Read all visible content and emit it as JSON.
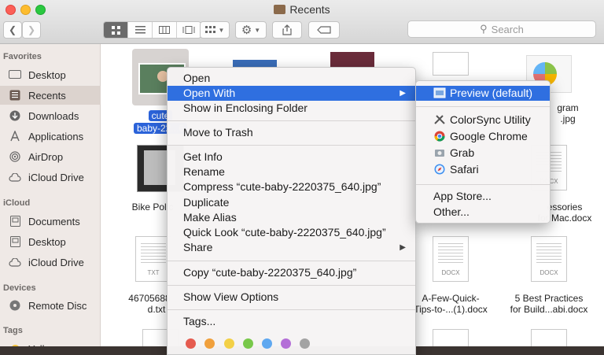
{
  "window": {
    "title": "Recents"
  },
  "toolbar": {
    "search_placeholder": "Search"
  },
  "sidebar": {
    "favorites_header": "Favorites",
    "favorites": [
      {
        "label": "Desktop",
        "icon": "desktop-icon"
      },
      {
        "label": "Recents",
        "icon": "recents-icon",
        "selected": true
      },
      {
        "label": "Downloads",
        "icon": "downloads-icon"
      },
      {
        "label": "Applications",
        "icon": "applications-icon"
      },
      {
        "label": "AirDrop",
        "icon": "airdrop-icon"
      },
      {
        "label": "iCloud Drive",
        "icon": "cloud-icon"
      }
    ],
    "icloud_header": "iCloud",
    "icloud": [
      {
        "label": "Documents",
        "icon": "documents-icon"
      },
      {
        "label": "Desktop",
        "icon": "desktop-icon"
      },
      {
        "label": "iCloud Drive",
        "icon": "cloud-icon"
      }
    ],
    "devices_header": "Devices",
    "devices": [
      {
        "label": "Remote Disc",
        "icon": "disc-icon"
      }
    ],
    "tags_header": "Tags",
    "tags": [
      {
        "label": "Yellow",
        "color": "#f5c33b"
      }
    ]
  },
  "files": {
    "selected_line1": "cute",
    "selected_line2": "baby-22...6",
    "bike": "Bike Polic",
    "d_line1": "46705688",
    "d_line2": "d.txt",
    "instagram_line1": "gram",
    "instagram_line2": ".jpg",
    "accessories_line1": "essories",
    "accessories_line2": "for Mac.docx",
    "quick_line1": "A-Few-Quick-",
    "quick_line2": "Tips-to-...(1).docx",
    "best_line1": "5 Best Practices",
    "best_line2": "for Build...abi.docx",
    "tag_txt": "TXT",
    "tag_docx": "DOCX"
  },
  "context_menu": {
    "open": "Open",
    "open_with": "Open With",
    "show_enclosing": "Show in Enclosing Folder",
    "move_trash": "Move to Trash",
    "get_info": "Get Info",
    "rename": "Rename",
    "compress": "Compress “cute-baby-2220375_640.jpg”",
    "duplicate": "Duplicate",
    "make_alias": "Make Alias",
    "quick_look": "Quick Look “cute-baby-2220375_640.jpg”",
    "share": "Share",
    "copy": "Copy “cute-baby-2220375_640.jpg”",
    "show_view_options": "Show View Options",
    "tags": "Tags...",
    "tag_colors": [
      "#e55b4f",
      "#f0a03c",
      "#f3d046",
      "#78c84a",
      "#5fa8f0",
      "#b46fd7",
      "#a3a3a3"
    ]
  },
  "submenu": {
    "preview": "Preview (default)",
    "colorsync": "ColorSync Utility",
    "chrome": "Google Chrome",
    "grab": "Grab",
    "safari": "Safari",
    "app_store": "App Store...",
    "other": "Other..."
  }
}
